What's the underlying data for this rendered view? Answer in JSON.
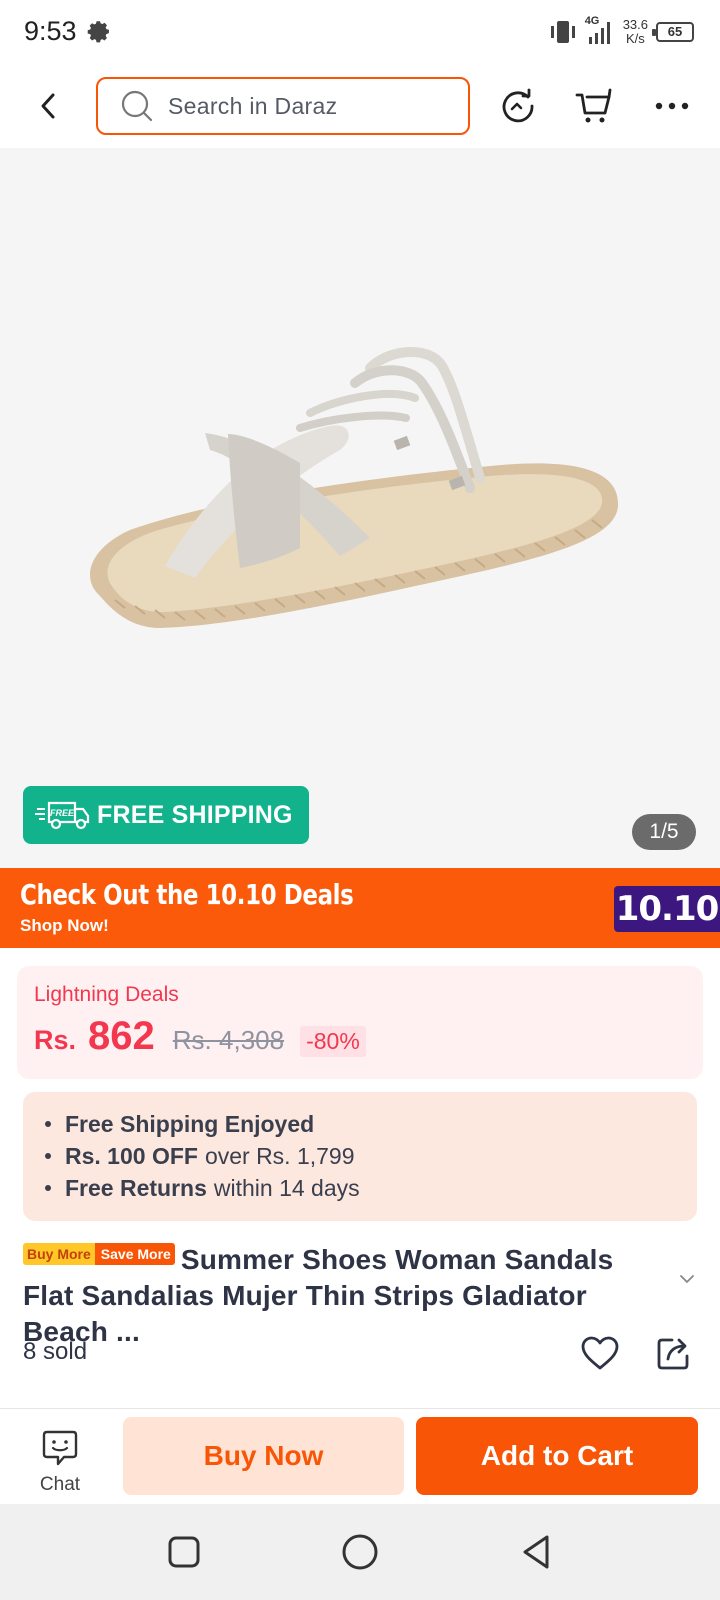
{
  "status_bar": {
    "time": "9:53",
    "network": "4G",
    "speed_value": "33.6",
    "speed_unit": "K/s",
    "battery": "65"
  },
  "header": {
    "search_placeholder": "Search in Daraz"
  },
  "gallery": {
    "counter": "1/5",
    "free_shipping_badge": "FREE SHIPPING",
    "free_badge_small": "FREE"
  },
  "deals_banner": {
    "title": "Check Out the 10.10 Deals",
    "subtitle": "Shop Now!",
    "badge": "10.10"
  },
  "lightning_deal": {
    "label": "Lightning Deals",
    "currency": "Rs.",
    "price": "862",
    "original_price": "Rs. 4,308",
    "discount": "-80%"
  },
  "perks": [
    {
      "bold": "Free Shipping Enjoyed",
      "rest": ""
    },
    {
      "bold": "Rs. 100 OFF",
      "rest": "over Rs. 1,799"
    },
    {
      "bold": "Free Returns",
      "rest": "within 14 days"
    }
  ],
  "product": {
    "promo_tag_left": "Buy More",
    "promo_tag_right": "Save More",
    "title": "Summer Shoes Woman Sandals Flat Sandalias Mujer Thin Strips Gladiator Beach ...",
    "sold": "8 sold"
  },
  "bottom_bar": {
    "chat_label": "Chat",
    "buy_now": "Buy Now",
    "add_to_cart": "Add to Cart"
  },
  "colors": {
    "brand_orange": "#f85606",
    "free_shipping_green": "#12b28c",
    "price_red": "#f2374f",
    "badge_purple": "#3d1780"
  }
}
